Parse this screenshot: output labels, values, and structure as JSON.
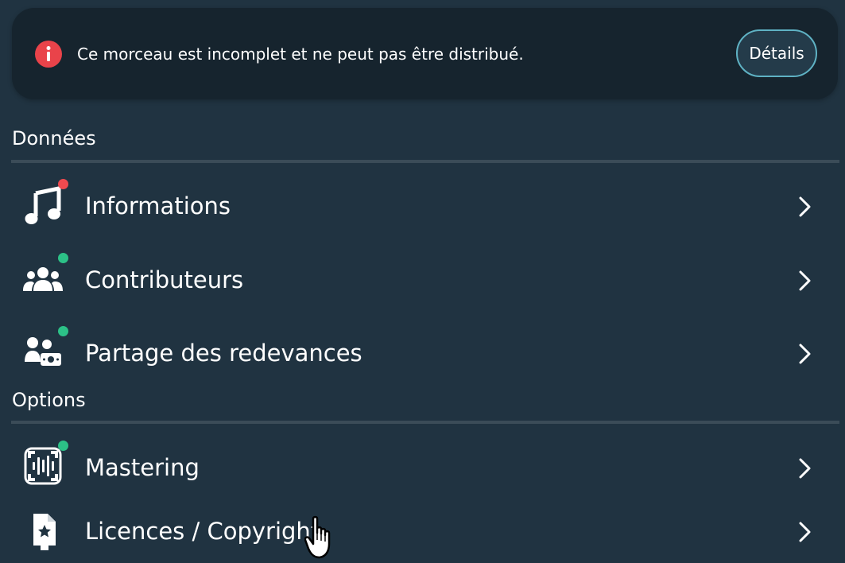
{
  "alert": {
    "message": "Ce morceau est incomplet et ne peut pas être distribué.",
    "details_label": "Détails",
    "icon": "exclamation-circle-icon"
  },
  "sections": {
    "data_title": "Données",
    "options_title": "Options"
  },
  "rows": [
    {
      "label": "Informations",
      "icon": "music-note-icon",
      "status": "incomplete",
      "status_color": "#ef4a4f"
    },
    {
      "label": "Contributeurs",
      "icon": "users-group-icon",
      "status": "complete",
      "status_color": "#2cc187"
    },
    {
      "label": "Partage des redevances",
      "icon": "users-money-icon",
      "status": "complete",
      "status_color": "#2cc187"
    },
    {
      "label": "Mastering",
      "icon": "waveform-icon",
      "status": "complete",
      "status_color": "#2cc187"
    },
    {
      "label": "Licences / Copyright",
      "icon": "certificate-icon"
    }
  ],
  "colors": {
    "background": "#203341",
    "alert_background": "#16242e",
    "alert_icon": "#e9434a",
    "button_border": "#5fb2c4"
  }
}
